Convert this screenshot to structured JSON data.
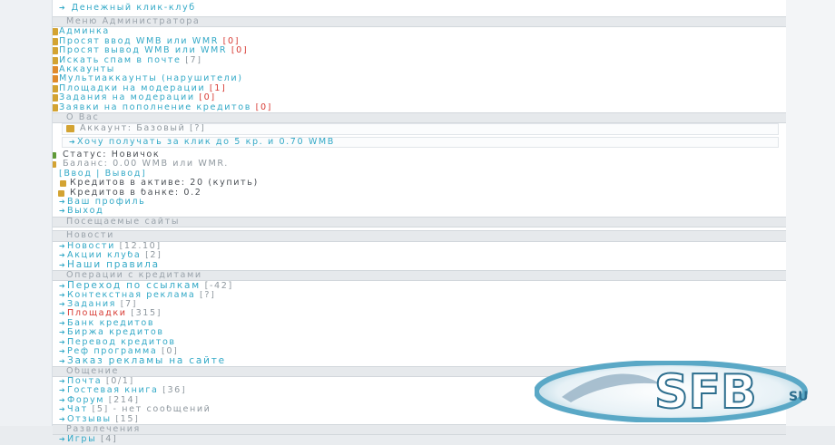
{
  "top_link": "Денежный клик-клуб",
  "sections": {
    "admin_menu": "Меню Администратора",
    "about_you": "О Вас",
    "visited_sites": "Посещаемые сайты",
    "news": "Новости",
    "credit_ops": "Операции с кредитами",
    "communication": "Общение",
    "entertainment": "Развлечения"
  },
  "admin": [
    {
      "label": "Админка",
      "count": ""
    },
    {
      "label": "Просят ввод WMB или WMR",
      "count": "[0]"
    },
    {
      "label": "Просят вывод WMB или WMR",
      "count": "[0]"
    },
    {
      "label": "Искать спам в почте",
      "count": "[7]"
    },
    {
      "label": "Аккаунты",
      "count": ""
    },
    {
      "label": "Мультиаккаунты (нарушители)",
      "count": ""
    },
    {
      "label": "Площадки на модерации",
      "count": "[1]"
    },
    {
      "label": "Задания на модерации",
      "count": "[0]"
    },
    {
      "label": "Заявки на пополнение кредитов",
      "count": "[0]"
    }
  ],
  "about": {
    "account_type": "Аккаунт: Базовый [?]",
    "earn": "Хочу получать за клик до 5 кр. и 0.70 WMB",
    "status": "Статус: Новичок",
    "balance": "Баланс: 0.00 WMB или WMR.",
    "io_links": "[Ввод | Вывод]",
    "credits_active": "Кредитов в активе: 20 (купить)",
    "credits_bank": "Кредитов в банке: 0.2",
    "profile": "Ваш профиль",
    "logout": "Выход"
  },
  "news": [
    {
      "label": "Новости",
      "count": "[12.10]"
    },
    {
      "label": "Акции клуба",
      "count": "[2]"
    },
    {
      "label": "Наши правила",
      "count": ""
    }
  ],
  "credit_ops": [
    {
      "label": "Переход по ссылкам",
      "count": "[-42]"
    },
    {
      "label": "Контекстная реклама",
      "count": "[?]"
    },
    {
      "label": "Задания",
      "count": "[7]"
    },
    {
      "label": "Площадки",
      "count": "[315]"
    },
    {
      "label": "Банк кредитов",
      "count": ""
    },
    {
      "label": "Биржа кредитов",
      "count": ""
    },
    {
      "label": "Перевод кредитов",
      "count": ""
    },
    {
      "label": "Реф программа",
      "count": "[0]"
    },
    {
      "label": "Заказ рекламы на сайте",
      "count": ""
    }
  ],
  "communication": [
    {
      "label": "Почта",
      "count": "[0/1]"
    },
    {
      "label": "Гостевая книга",
      "count": "[36]"
    },
    {
      "label": "Форум",
      "count": "[214]"
    },
    {
      "label": "Чат",
      "count": "[5] - нет сообщений"
    },
    {
      "label": "Отзывы",
      "count": "[15]"
    }
  ],
  "entertainment": [
    {
      "label": "Игры",
      "count": "[4]"
    }
  ],
  "logo": {
    "text": "SFB",
    "suffix": "SU"
  },
  "colors": {
    "link": "#33a9c7",
    "accent_red": "#d73a33",
    "header_bg": "#e6e9ec"
  }
}
